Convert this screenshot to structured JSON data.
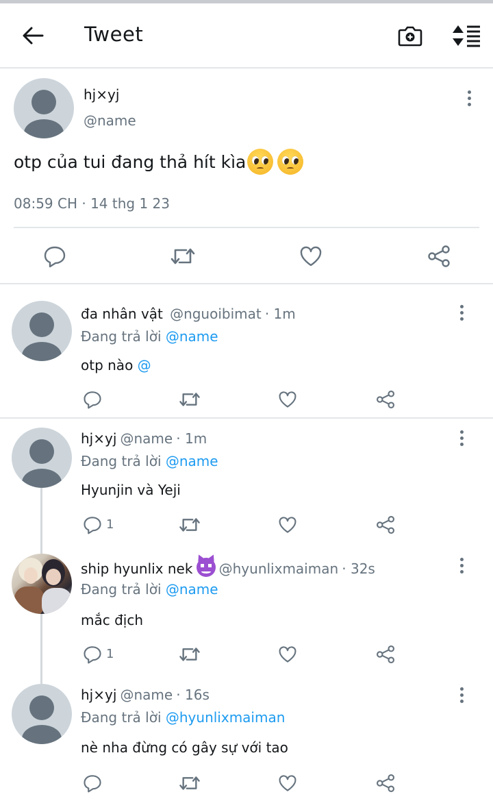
{
  "header": {
    "title": "Tweet"
  },
  "main_tweet": {
    "name": "hj×yj",
    "handle": "@name",
    "text": "otp của tui đang thả hít kìa",
    "emoji": [
      "pleading-face",
      "pleading-face"
    ],
    "timestamp": "08:59 CH · 14 thg 1 23"
  },
  "replies": [
    {
      "name": "đa nhân vật",
      "handle": "@nguoibimat",
      "time": "· 1m",
      "replying_prefix": "Đang trả lời",
      "replying_to": "@name",
      "text": "otp nào",
      "text_link": "@",
      "reply_count": ""
    },
    {
      "name": "hj×yj",
      "handle": "@name",
      "time": "· 1m",
      "replying_prefix": "Đang trả lời",
      "replying_to": "@name",
      "text": "Hyunjin và Yeji",
      "reply_count": "1"
    },
    {
      "name": "ship hyunlix nek",
      "name_emoji": "smiling-devil",
      "handle": "@hyunlixmaiman",
      "time": "· 32s",
      "replying_prefix": "Đang trả lời",
      "replying_to": "@name",
      "text": "mắc địch",
      "reply_count": "1"
    },
    {
      "name": "hj×yj",
      "handle": "@name",
      "time": "· 16s",
      "replying_prefix": "Đang trả lời",
      "replying_to": "@hyunlixmaiman",
      "text": "nè nha đừng có gây sự với tao",
      "reply_count": ""
    }
  ],
  "colors": {
    "accent": "#1d9bf0",
    "secondary_text": "#66737e",
    "divider": "#e3e6e9"
  }
}
